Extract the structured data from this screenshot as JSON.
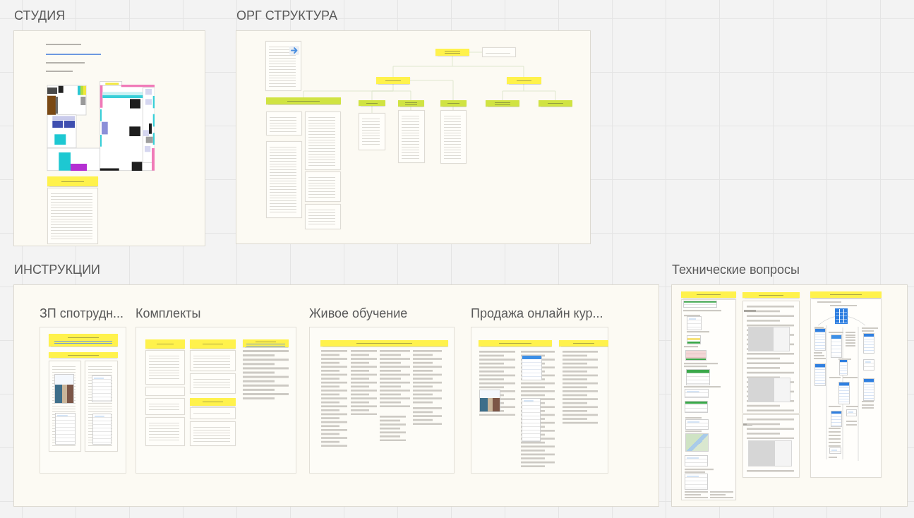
{
  "board": {
    "frames": [
      {
        "title": "СТУДИЯ"
      },
      {
        "title": "ОРГ СТРУКТУРА"
      },
      {
        "title": "ИНСТРУКЦИИ",
        "subframes": [
          {
            "title": "ЗП спотрудн..."
          },
          {
            "title": "Комплекты"
          },
          {
            "title": "Живое обучение"
          },
          {
            "title": "Продажа онлайн кур..."
          }
        ]
      },
      {
        "title": "Технические вопросы"
      }
    ]
  }
}
